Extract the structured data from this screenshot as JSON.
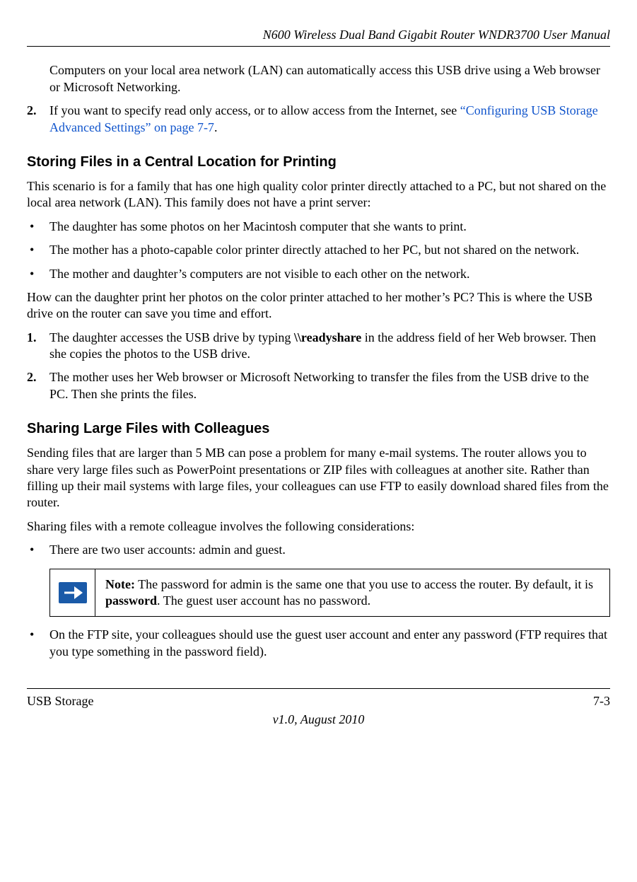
{
  "header": {
    "title": "N600 Wireless Dual Band Gigabit Router WNDR3700 User Manual"
  },
  "content": {
    "intro_para": "Computers on your local area network (LAN) can automatically access this USB drive using a Web browser or Microsoft Networking.",
    "step2_prefix": "If you want to specify read only access, or to allow access from the Internet, see ",
    "step2_link": "“Configuring USB Storage Advanced Settings” on page 7-7",
    "step2_suffix": ".",
    "section1_heading": "Storing Files in a Central Location for Printing",
    "section1_intro": "This scenario is for a family that has one high quality color printer directly attached to a PC, but not shared on the local area network (LAN). This family does not have a print server:",
    "section1_bullets": [
      "The daughter has some photos on her Macintosh computer that she wants to print.",
      "The mother has a photo-capable color printer directly attached to her PC, but not shared on the network.",
      "The mother and daughter’s computers are not visible to each other on the network."
    ],
    "section1_mid": "How can the daughter print her photos on the color printer attached to her mother’s PC? This is where the USB drive on the router can save you time and effort.",
    "section1_step1_a": "The daughter accesses the USB drive by typing ",
    "section1_step1_bold": "\\\\readyshare",
    "section1_step1_b": " in the address field of her Web browser. Then she copies the photos to the USB drive.",
    "section1_step2": "The mother uses her Web browser or Microsoft Networking to transfer the files from the USB drive to the PC. Then she prints the files.",
    "section2_heading": "Sharing Large Files with Colleagues",
    "section2_intro": "Sending files that are larger than 5 MB can pose a problem for many e-mail systems. The router allows you to share very large files such as PowerPoint presentations or ZIP files with colleagues at another site. Rather than filling up their mail systems with large files, your colleagues can use FTP to easily download shared files from the router.",
    "section2_mid": "Sharing files with a remote colleague involves the following considerations:",
    "section2_bullet1": "There are two user accounts: admin and guest.",
    "note_label": "Note:",
    "note_text_a": " The password for admin is the same one that you use to access the router. By default, it is ",
    "note_bold": "password",
    "note_text_b": ". The guest user account has no password.",
    "section2_bullet2": "On the FTP site, your colleagues should use the guest user account and enter any password (FTP requires that you type something in the password field)."
  },
  "footer": {
    "left": "USB Storage",
    "right": "7-3",
    "version": "v1.0, August 2010"
  }
}
